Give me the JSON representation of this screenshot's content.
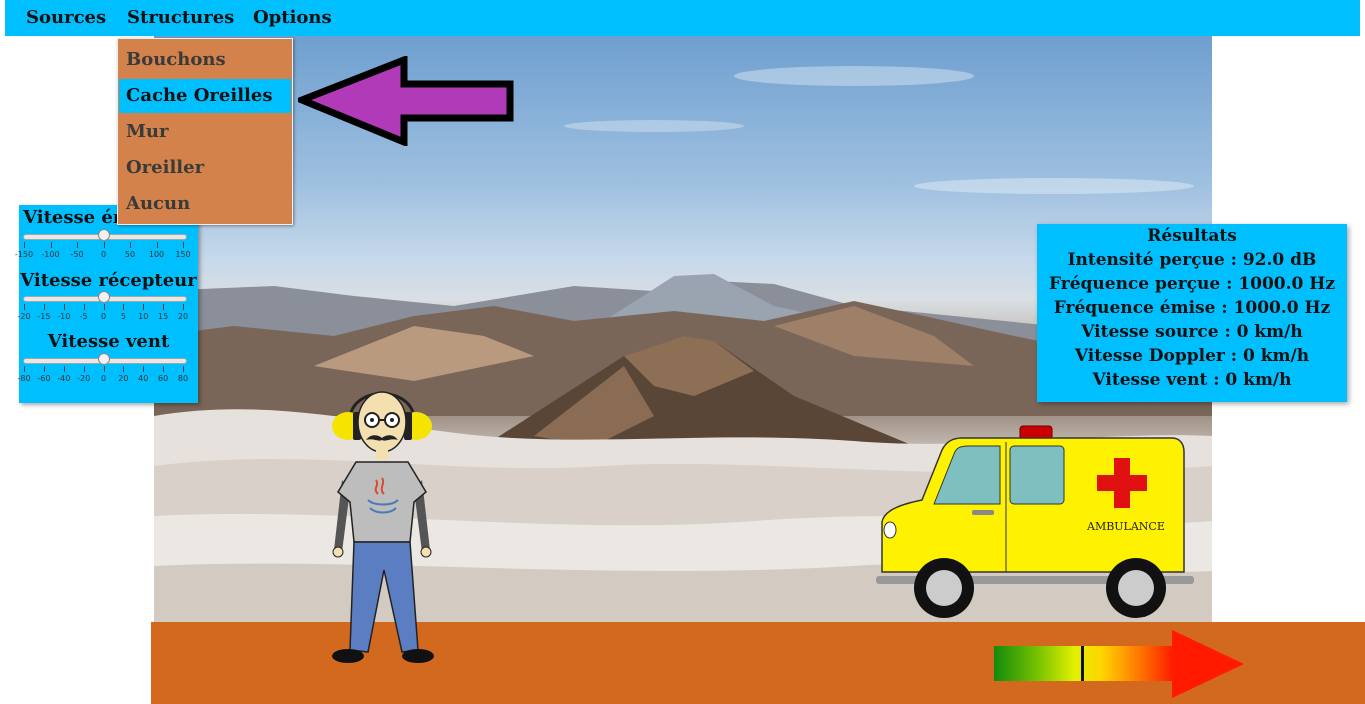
{
  "menubar": {
    "items": [
      "Sources",
      "Structures",
      "Options"
    ]
  },
  "structures_menu": {
    "items": [
      "Bouchons",
      "Cache Oreilles",
      "Mur",
      "Oreiller",
      "Aucun"
    ],
    "selected": "Cache Oreilles"
  },
  "sliders": [
    {
      "label": "Vitesse émetteur",
      "value": 0,
      "ticks": [
        "-150",
        "-100",
        "-50",
        "0",
        "50",
        "100",
        "150"
      ]
    },
    {
      "label": "Vitesse récepteur",
      "value": 0,
      "ticks": [
        "-20",
        "-15",
        "-10",
        "-5",
        "0",
        "5",
        "10",
        "15",
        "20"
      ]
    },
    {
      "label": "Vitesse vent",
      "value": 0,
      "ticks": [
        "-80",
        "-60",
        "-40",
        "-20",
        "0",
        "20",
        "40",
        "60",
        "80"
      ]
    }
  ],
  "results": {
    "title": "Résultats",
    "lines": [
      "Intensité perçue : 92.0 dB",
      "Fréquence perçue : 1000.0 Hz",
      "Fréquence émise : 1000.0 Hz",
      "Vitesse source : 0 km/h",
      "Vitesse Doppler : 0 km/h",
      "Vitesse vent : 0 km/h"
    ]
  },
  "ambulance": {
    "label": "AMBULANCE"
  },
  "gauge": {
    "level": 0.49
  },
  "colors": {
    "menubar": "#00bfff",
    "dropdown": "#d2824a",
    "ground": "#d2691e",
    "arrow_pointer": "#b03ab8",
    "arrow_direction": "#ff1a00"
  }
}
